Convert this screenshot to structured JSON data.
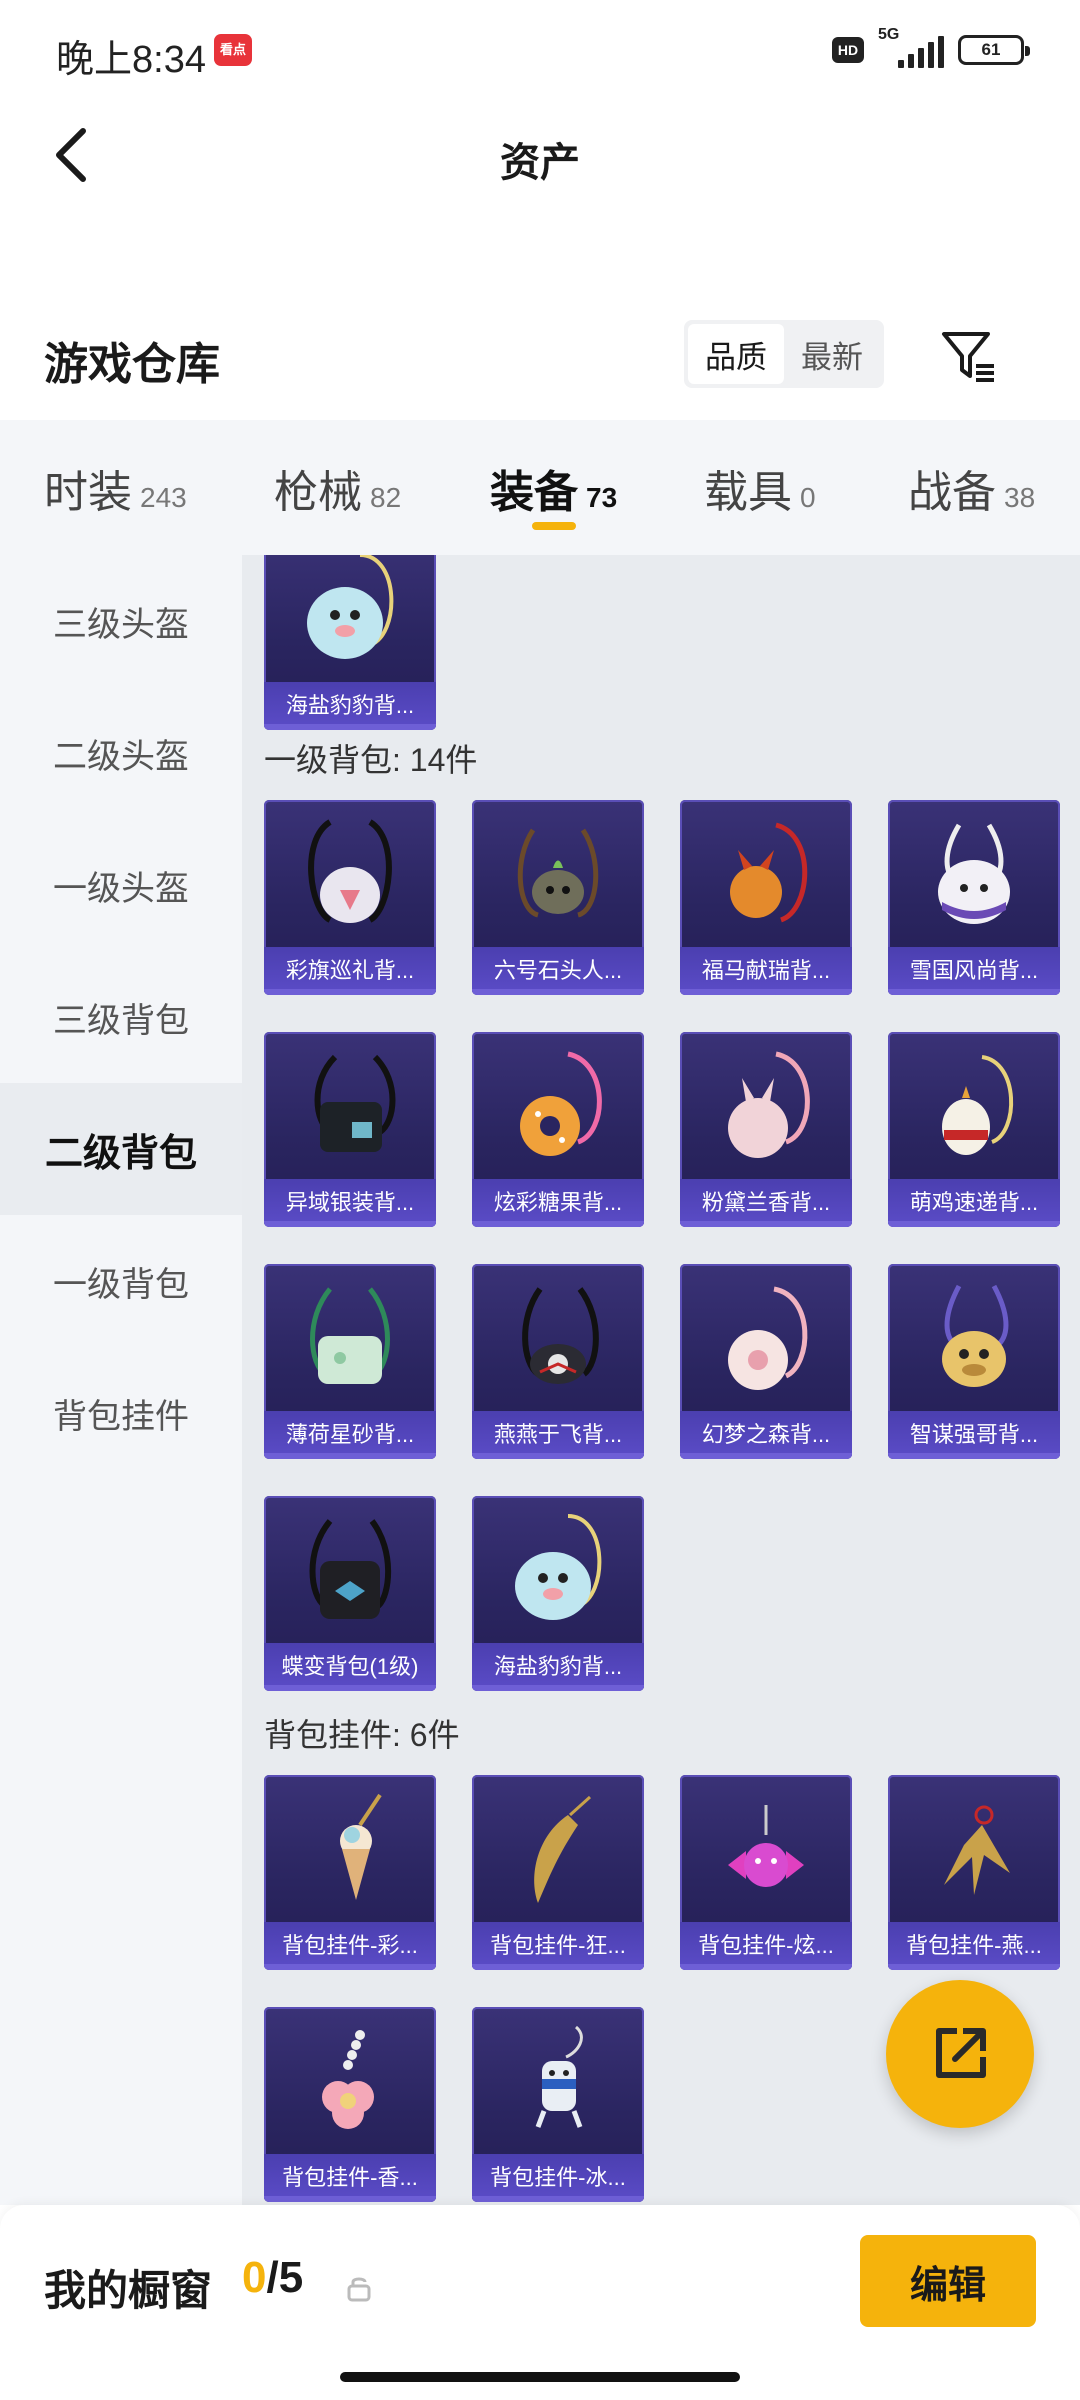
{
  "status_bar": {
    "time": "晚上8:34",
    "app_badge": "看点",
    "hd": "HD",
    "network": "5G",
    "battery": "61"
  },
  "header": {
    "title": "资产",
    "back_icon": "chevron-left-icon"
  },
  "warehouse": {
    "title": "游戏仓库",
    "sort_options": [
      "品质",
      "最新"
    ],
    "sort_selected": "品质",
    "filter_icon": "filter-icon"
  },
  "category_tabs": [
    {
      "name": "时装",
      "count": "243"
    },
    {
      "name": "枪械",
      "count": "82"
    },
    {
      "name": "装备",
      "count": "73"
    },
    {
      "name": "载具",
      "count": "0"
    },
    {
      "name": "战备",
      "count": "38"
    }
  ],
  "active_category": "装备",
  "sidebar": {
    "items": [
      "三级头盔",
      "二级头盔",
      "一级头盔",
      "三级背包",
      "二级背包",
      "一级背包",
      "背包挂件"
    ],
    "active": "二级背包"
  },
  "sections": [
    {
      "title": "",
      "items": [
        "海盐豹豹背..."
      ]
    },
    {
      "title": "一级背包: 14件",
      "items": [
        "彩旗巡礼背...",
        "六号石头人...",
        "福马献瑞背...",
        "雪国风尚背...",
        "异域银装背...",
        "炫彩糖果背...",
        "粉黛兰香背...",
        "萌鸡速递背...",
        "薄荷星砂背...",
        "燕燕于飞背...",
        "幻梦之森背...",
        "智谋强哥背...",
        "蝶变背包(1级)",
        "海盐豹豹背..."
      ]
    },
    {
      "title": "背包挂件: 6件",
      "items": [
        "背包挂件-彩...",
        "背包挂件-狂...",
        "背包挂件-炫...",
        "背包挂件-燕...",
        "背包挂件-香...",
        "背包挂件-冰..."
      ]
    }
  ],
  "fab_icon": "share-icon",
  "bottom_bar": {
    "label": "我的橱窗",
    "current": "0",
    "separator": "/",
    "max": "5",
    "lock_icon": "lock-icon",
    "edit_label": "编辑"
  },
  "colors": {
    "accent": "#f5b30c",
    "card_bg": "#2a2560",
    "card_label": "#5b4cc7"
  }
}
